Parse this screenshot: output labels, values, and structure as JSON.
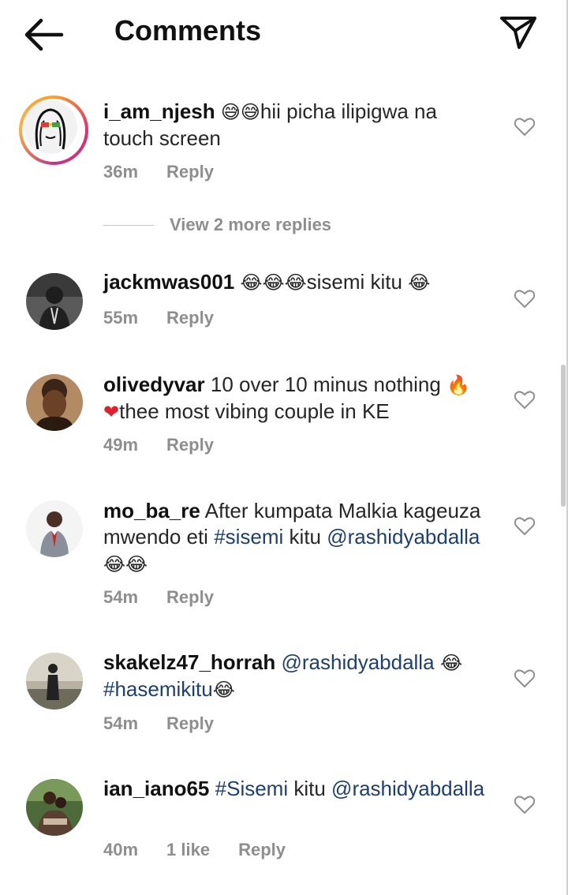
{
  "header": {
    "title": "Comments",
    "back_icon": "arrow-left-icon",
    "send_icon": "paper-plane-icon"
  },
  "colors": {
    "username": "#111111",
    "link": "#1d3f73",
    "meta": "#8e8e8e",
    "story_ring": [
      "#f9a12e",
      "#e1306c",
      "#c13584"
    ]
  },
  "comments": [
    {
      "username": "i_am_njesh",
      "emoji_prefix": "😅😅",
      "text_1": "hii picha ilipigwa na touch screen",
      "time": "36m",
      "reply": "Reply",
      "more_replies": "View 2 more replies"
    },
    {
      "username": "jackmwas001",
      "emoji_prefix": "😂😂😂",
      "text_1": "sisemi kitu ",
      "emoji_suffix": "😂",
      "time": "55m",
      "reply": "Reply"
    },
    {
      "username": "olivedyvar",
      "text_1": " 10 over 10 minus nothing ",
      "emoji_1": "🔥",
      "emoji_2": "❤",
      "text_2": "thee most vibing couple in KE",
      "time": "49m",
      "reply": "Reply"
    },
    {
      "username": "mo_ba_re",
      "text_1": " After kumpata Malkia kageuza mwendo eti ",
      "hashtag": "#sisemi",
      "text_2": " kitu ",
      "mention": "@rashidyabdalla",
      "emoji_suffix": " 😂😂",
      "time": "54m",
      "reply": "Reply"
    },
    {
      "username": "skakelz47_horrah",
      "mention": "@rashidyabdalla",
      "emoji_1": " 😂",
      "hashtag": "#hasemikitu",
      "emoji_2": "😂",
      "time": "54m",
      "reply": "Reply"
    },
    {
      "username": "ian_iano65",
      "hashtag": "#Sisemi",
      "text_1": " kitu ",
      "mention": "@rashidyabdalla",
      "time": "40m",
      "likes": "1 like",
      "reply": "Reply"
    }
  ]
}
